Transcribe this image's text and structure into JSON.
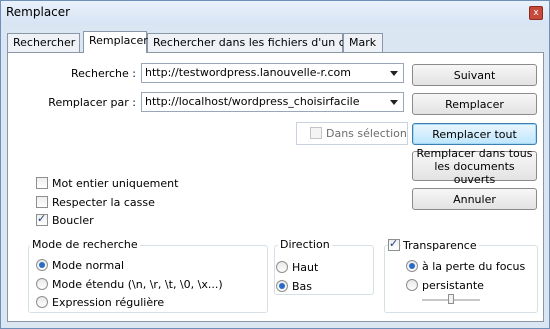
{
  "window": {
    "title": "Remplacer",
    "close_label": "x"
  },
  "tabs": [
    {
      "label": "Rechercher",
      "active": false
    },
    {
      "label": "Remplacer",
      "active": true
    },
    {
      "label": "Rechercher dans les fichiers d'un dossier",
      "active": false
    },
    {
      "label": "Mark",
      "active": false
    }
  ],
  "fields": {
    "search_label": "Recherche :",
    "search_value": "http://testwordpress.lanouvelle-r.com",
    "replace_label": "Remplacer par :",
    "replace_value": "http://localhost/wordpress_choisirfacile"
  },
  "buttons": {
    "next": "Suivant",
    "replace": "Remplacer",
    "replace_all": "Remplacer tout",
    "replace_all_docs": "Remplacer dans tous les documents ouverts",
    "cancel": "Annuler"
  },
  "in_selection": {
    "label": "Dans sélection",
    "checked": false,
    "enabled": false
  },
  "options": [
    {
      "label": "Mot entier uniquement",
      "checked": false
    },
    {
      "label": "Respecter la casse",
      "checked": false
    },
    {
      "label": "Boucler",
      "checked": true
    }
  ],
  "search_mode": {
    "title": "Mode de recherche",
    "items": [
      {
        "label": "Mode normal",
        "selected": true
      },
      {
        "label": "Mode étendu (\\n, \\r, \\t, \\0, \\x...)",
        "selected": false
      },
      {
        "label": "Expression régulière",
        "selected": false
      }
    ]
  },
  "direction": {
    "title": "Direction",
    "items": [
      {
        "label": "Haut",
        "selected": false
      },
      {
        "label": "Bas",
        "selected": true
      }
    ]
  },
  "transparency": {
    "title": "Transparence",
    "enabled": true,
    "items": [
      {
        "label": "à la perte du focus",
        "selected": true
      },
      {
        "label": "persistante",
        "selected": false
      }
    ],
    "slider_level": 0.5
  }
}
